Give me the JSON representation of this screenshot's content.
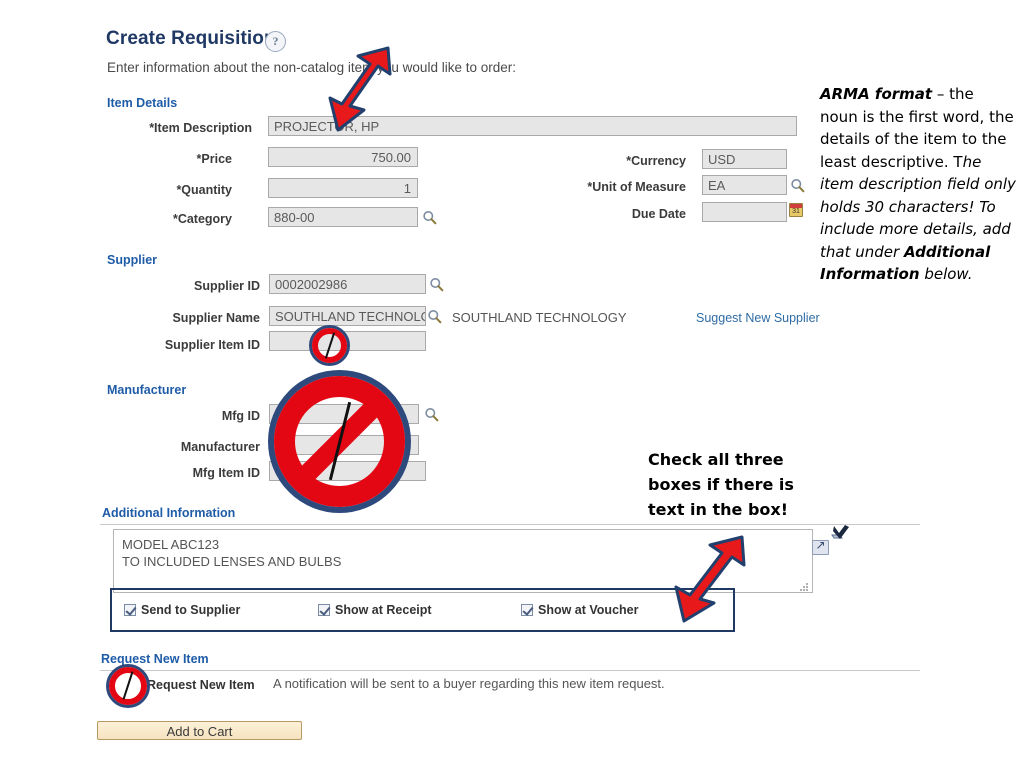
{
  "header": {
    "title": "Create Requisition",
    "help_icon": "question-mark-icon",
    "intro": "Enter information about the non-catalog item you would like to order:"
  },
  "sections": {
    "item_details": {
      "heading": "Item Details",
      "fields": {
        "item_description": {
          "label": "*Item Description",
          "value": "PROJECTOR, HP"
        },
        "price": {
          "label": "*Price",
          "value": "750.00"
        },
        "quantity": {
          "label": "*Quantity",
          "value": "1"
        },
        "category": {
          "label": "*Category",
          "value": "880-00",
          "lookup": "magnifier-icon"
        },
        "currency": {
          "label": "*Currency",
          "value": "USD"
        },
        "unit_of_measure": {
          "label": "*Unit of Measure",
          "value": "EA",
          "lookup": "magnifier-icon"
        },
        "due_date": {
          "label": "Due Date",
          "value": "",
          "picker": "calendar-icon",
          "picker_glyph": "31"
        }
      }
    },
    "supplier": {
      "heading": "Supplier",
      "fields": {
        "supplier_id": {
          "label": "Supplier ID",
          "value": "0002002986",
          "lookup": "magnifier-icon"
        },
        "supplier_name": {
          "label": "Supplier Name",
          "value": "SOUTHLAND TECHNOLOG",
          "resolved": "SOUTHLAND TECHNOLOGY",
          "lookup": "magnifier-icon"
        },
        "supplier_item_id": {
          "label": "Supplier Item ID",
          "value": ""
        }
      },
      "suggest_link": "Suggest New Supplier"
    },
    "manufacturer": {
      "heading": "Manufacturer",
      "fields": {
        "mfg_id": {
          "label": "Mfg ID",
          "value": "",
          "lookup": "magnifier-icon"
        },
        "manufacturer": {
          "label": "Manufacturer",
          "value": ""
        },
        "mfg_item_id": {
          "label": "Mfg Item ID",
          "value": ""
        }
      }
    },
    "additional_information": {
      "heading": "Additional Information",
      "comments": "MODEL ABC123\nTO INCLUDED LENSES AND BULBS",
      "expand_icon": "expand-icon",
      "spellcheck_icon": "spellcheck-icon",
      "checkboxes": [
        {
          "label": "Send to Supplier",
          "checked": true
        },
        {
          "label": "Show at Receipt",
          "checked": true
        },
        {
          "label": "Show at Voucher",
          "checked": true
        }
      ]
    },
    "request_new_item": {
      "heading": "Request New Item",
      "checkbox_label": "Request New Item",
      "note": "A notification will be sent to a buyer regarding this new item request."
    }
  },
  "actions": {
    "add_to_cart": "Add to Cart"
  },
  "annotations": {
    "arma": {
      "lead": "ARMA format",
      "line1": " – the noun is the first word, the details of the item to the least descriptive. T",
      "line2": "he item description field only holds 30 characters! To include more details, add that under ",
      "emphasis": "Additional Information",
      "tail": " below."
    },
    "check_boxes": "Check all three boxes if there is text in the box!"
  },
  "colors": {
    "title": "#1f3864",
    "section_heading": "#1f5ca8",
    "link": "#2f6ca5",
    "arrow_fill": "#e8191b",
    "arrow_stroke": "#22406e",
    "field_bg": "#e6e6e6",
    "button_bg": "#f7e6c4"
  }
}
